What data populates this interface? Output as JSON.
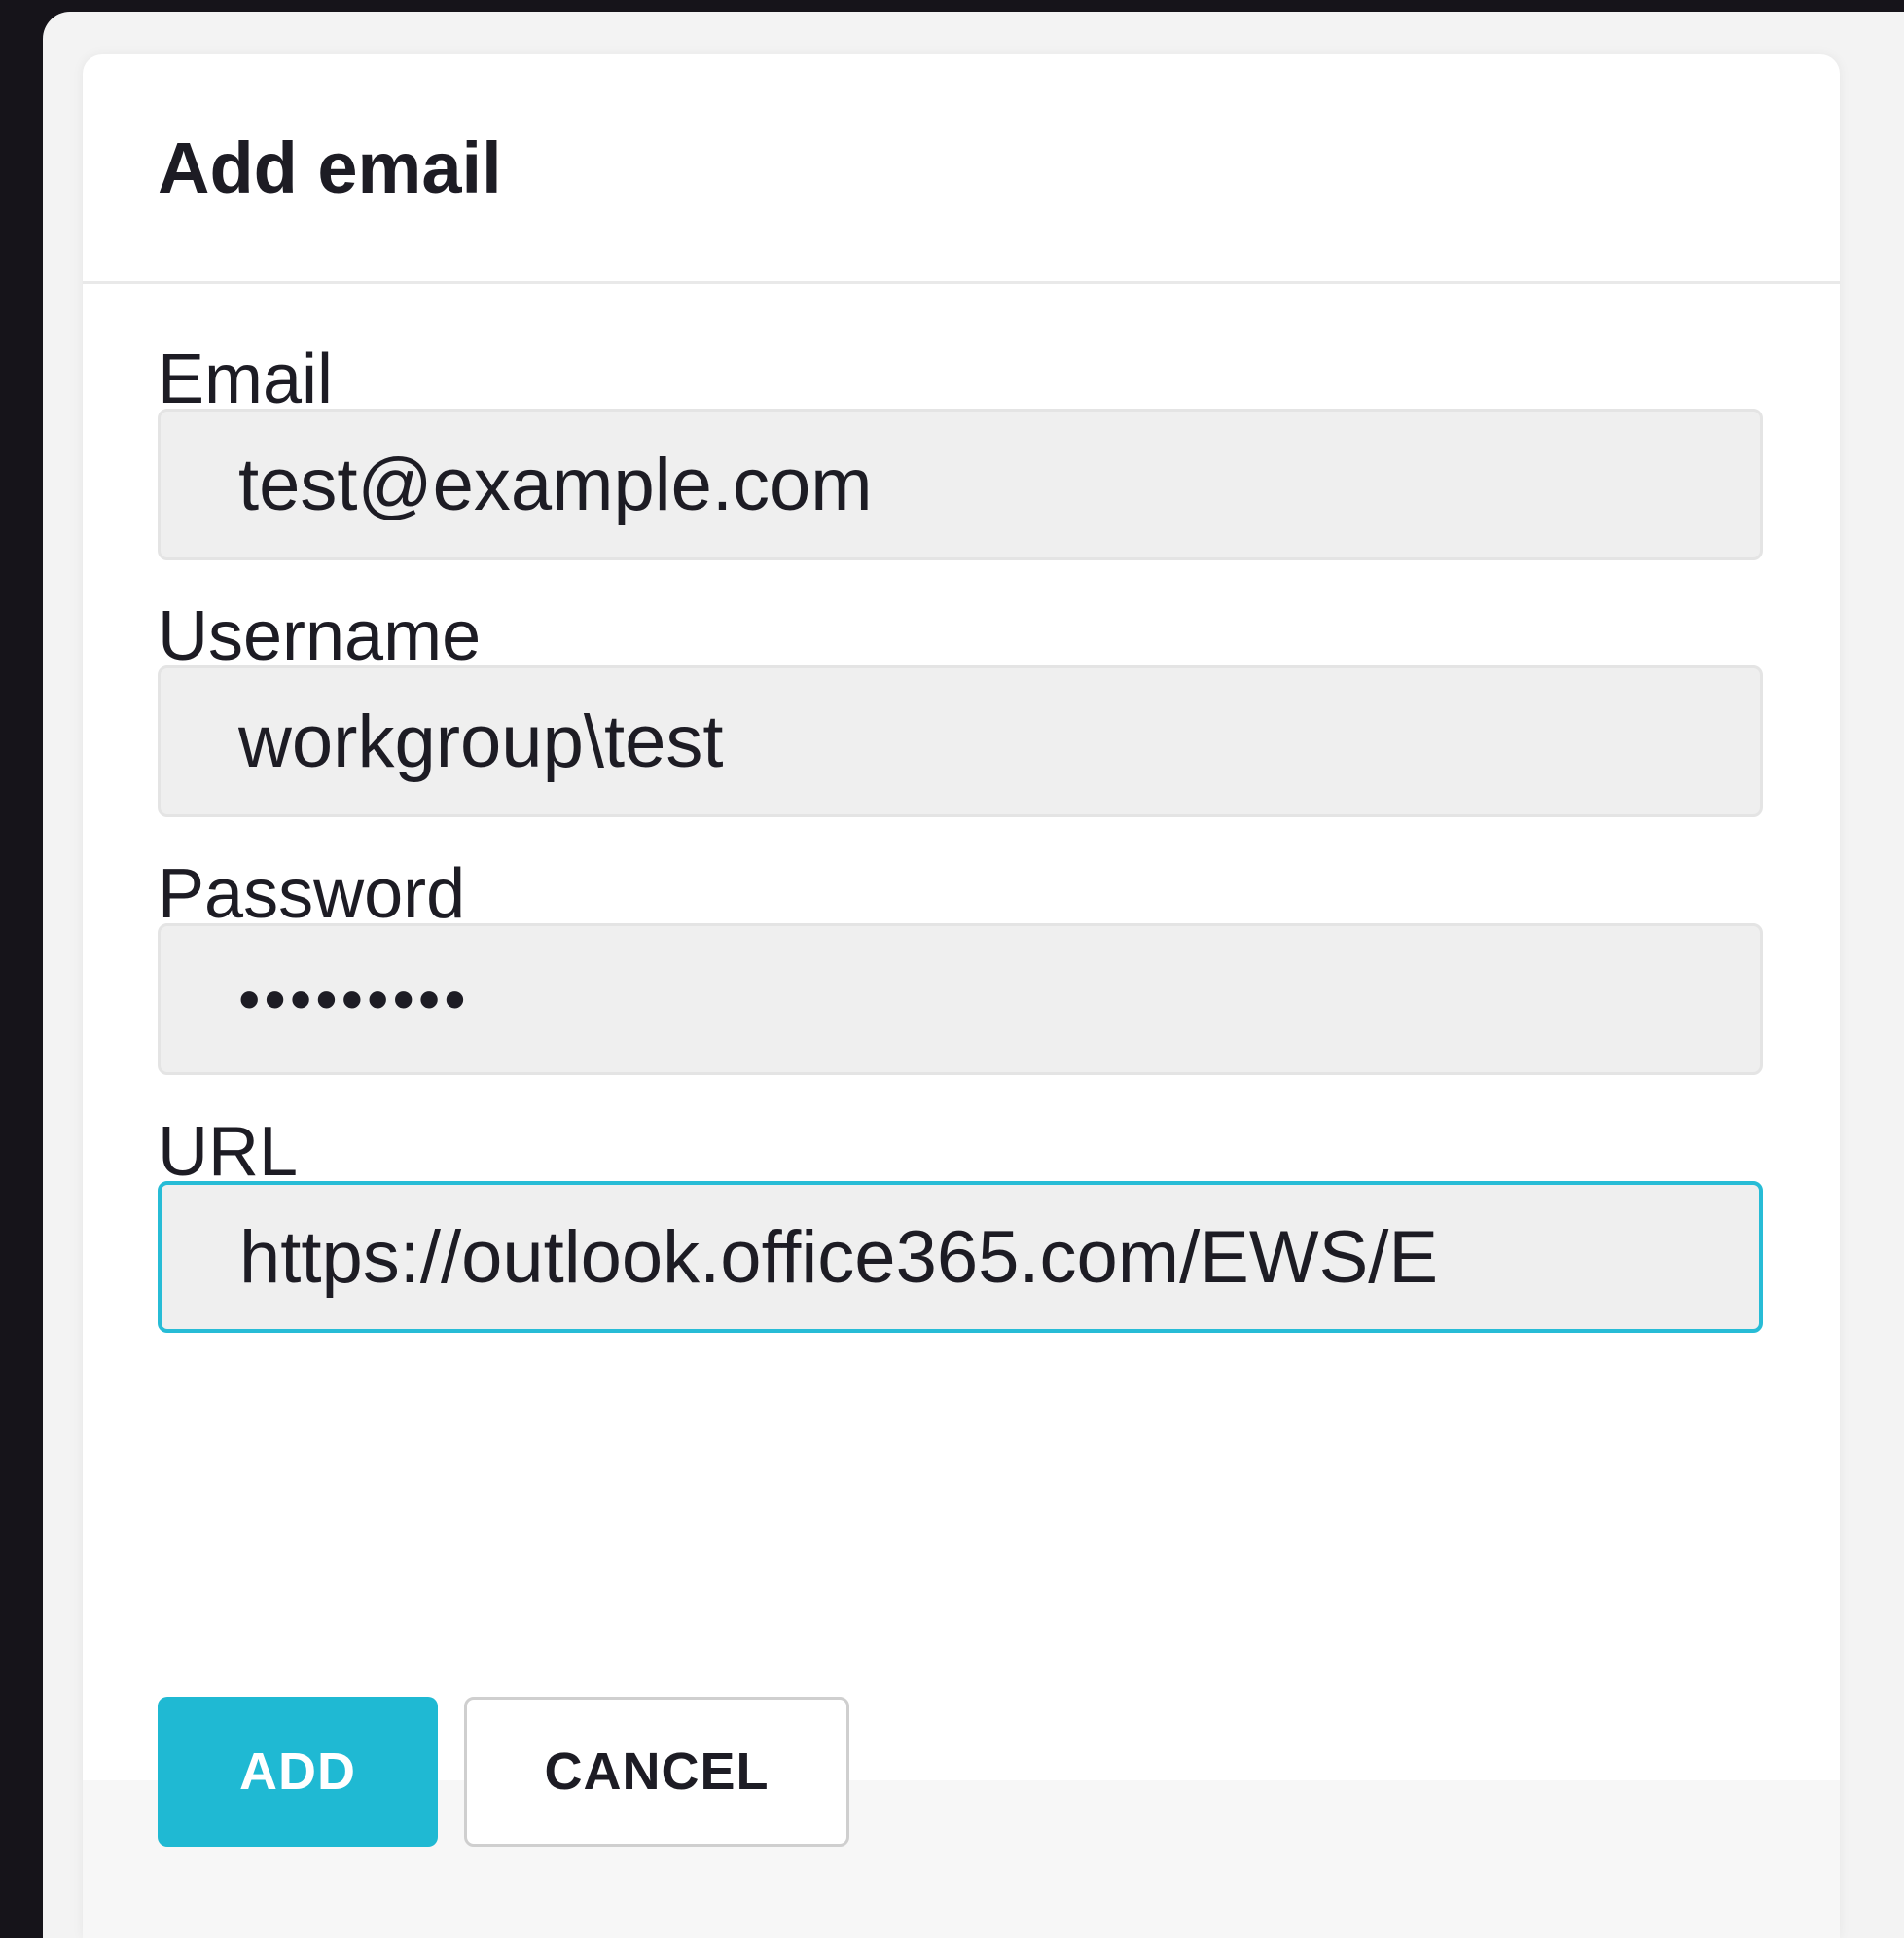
{
  "dialog": {
    "title": "Add email"
  },
  "fields": {
    "email": {
      "label": "Email",
      "value": "test@example.com"
    },
    "username": {
      "label": "Username",
      "value": "workgroup\\test"
    },
    "password": {
      "label": "Password",
      "value": "•••••••••"
    },
    "url": {
      "label": "URL",
      "value": "https://outlook.office365.com/EWS/E"
    }
  },
  "buttons": {
    "add_label": "ADD",
    "cancel_label": "CANCEL"
  },
  "colors": {
    "accent": "#1fb9d3",
    "focus_border": "#27bcd6",
    "backdrop": "#16141a",
    "text": "#1d1c24"
  }
}
